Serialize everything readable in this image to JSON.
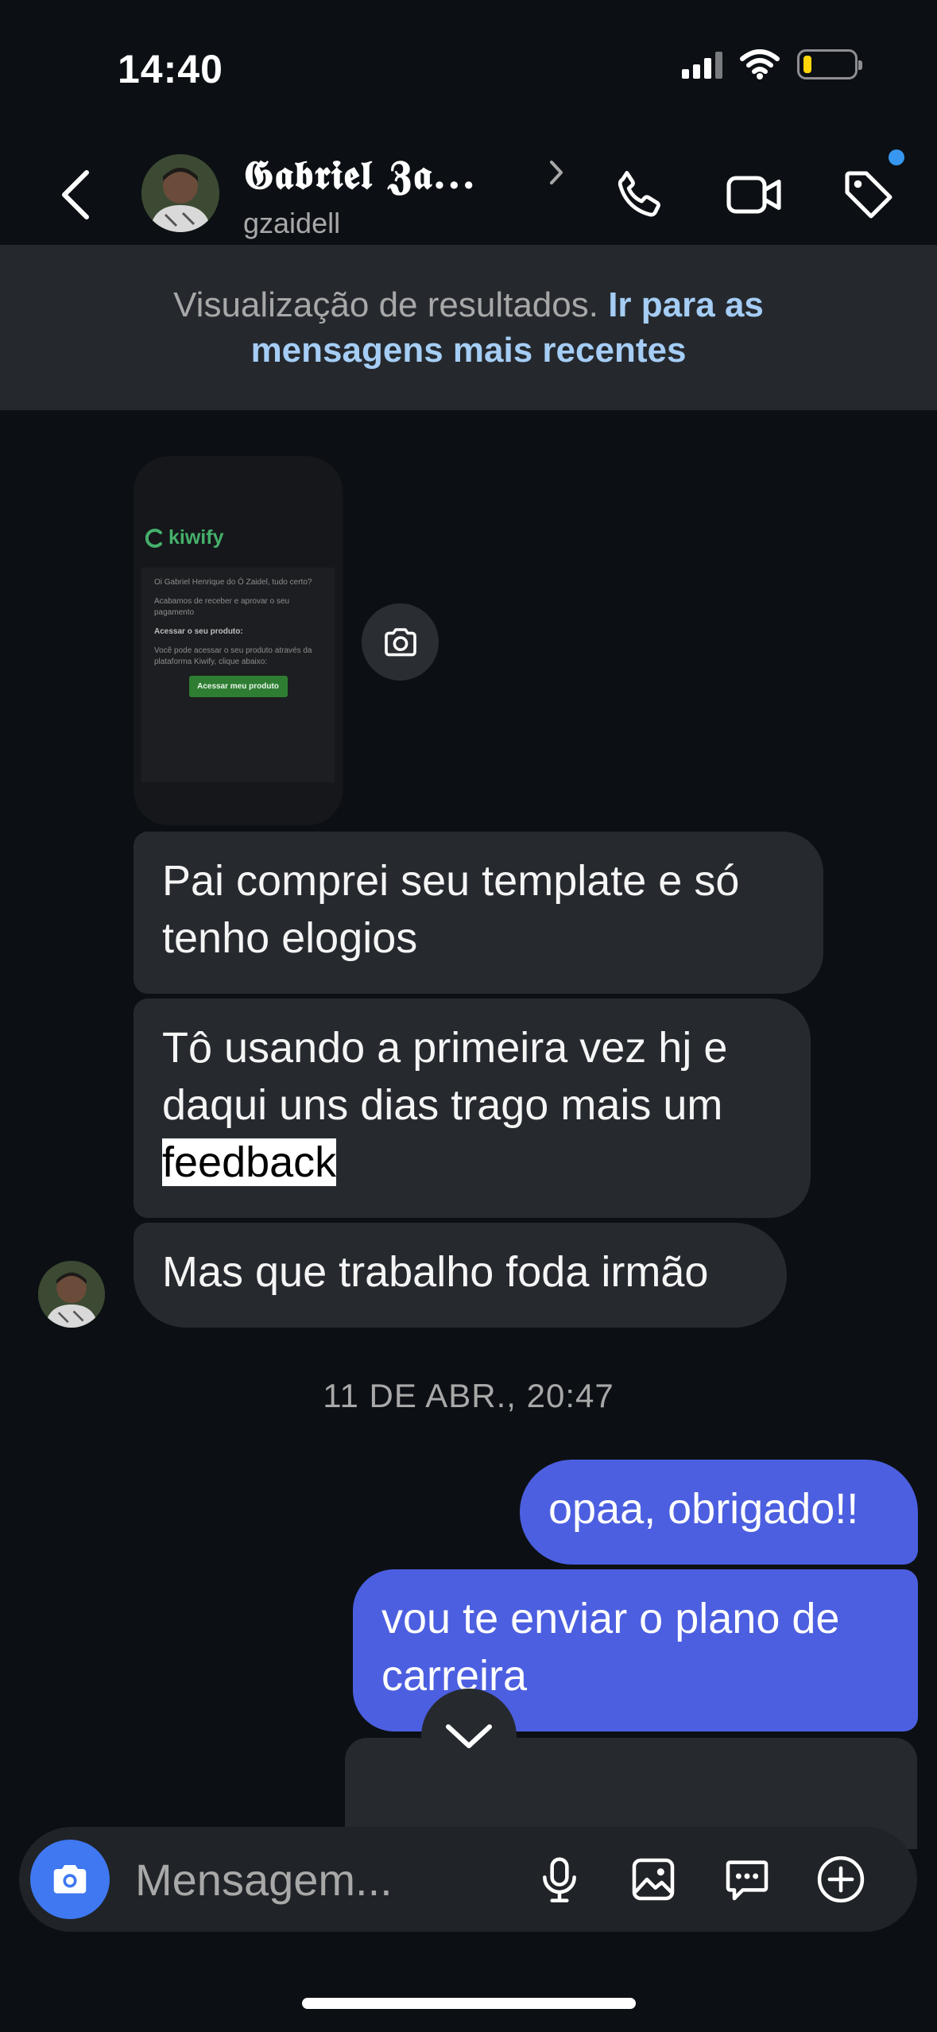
{
  "status_bar": {
    "time": "14:40"
  },
  "header": {
    "contact_name": "𝕲𝖆𝖇𝖗𝖎𝖊𝖑 𝖅𝖆...",
    "username": "gzaidell",
    "icons": [
      "back-chevron-icon",
      "name-chevron-icon",
      "phone-icon",
      "video-icon",
      "tag-icon"
    ],
    "notification_dot_color": "#3797f0"
  },
  "banner": {
    "text": "Visualização de resultados.",
    "link": "Ir para as mensagens mais recentes"
  },
  "shared_image": {
    "brand": "kiwify",
    "lines": [
      "Oi Gabriel Henrique do Ó Zaidel, tudo certo?",
      "Acabamos de receber e aprovar o seu pagamento",
      "Acessar o seu produto:",
      "Você pode acessar o seu produto através da plataforma Kiwify, clique abaixo:"
    ],
    "button": "Acessar meu produto"
  },
  "messages_in": [
    {
      "text": "Pai comprei seu template e só tenho elogios"
    },
    {
      "text_before": "Tô usando a primeira vez hj e daqui uns dias trago mais um ",
      "highlight": "feedback"
    },
    {
      "text": "Mas que trabalho foda irmão"
    }
  ],
  "timestamp": "11 DE ABR., 20:47",
  "messages_out": [
    {
      "text": "opaa, obrigado!!"
    },
    {
      "text": "vou te enviar o plano de carreira"
    }
  ],
  "composer": {
    "placeholder": "Mensagem...",
    "icons": [
      "camera-icon",
      "microphone-icon",
      "gallery-icon",
      "sticker-icon",
      "plus-icon"
    ]
  },
  "colors": {
    "background": "#0c1014",
    "incoming_bubble": "#262a2f",
    "outgoing_bubble": "#4c5fe0",
    "banner": "#25292e",
    "link": "#a5cdf5"
  }
}
